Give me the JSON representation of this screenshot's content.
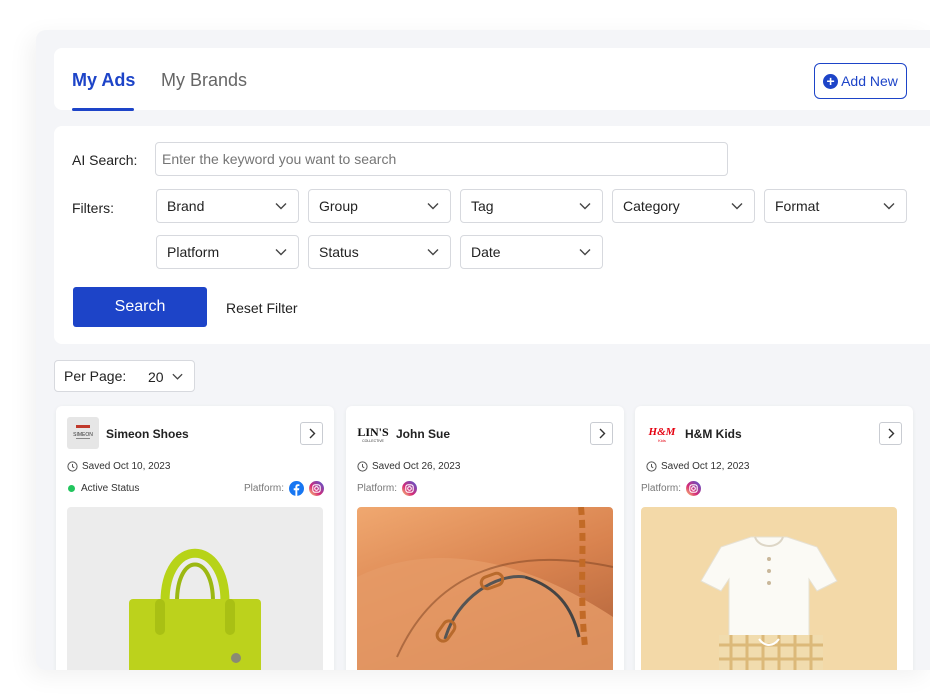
{
  "tabs": [
    {
      "label": "My Ads",
      "active": true
    },
    {
      "label": "My Brands",
      "active": false
    }
  ],
  "add_new": {
    "label": "Add New"
  },
  "ai_search": {
    "label": "AI Search:",
    "placeholder": "Enter the keyword you want to search",
    "value": ""
  },
  "filters": {
    "label": "Filters:",
    "dropdowns": [
      "Brand",
      "Group",
      "Tag",
      "Category",
      "Format",
      "Platform",
      "Status",
      "Date"
    ]
  },
  "search_button": "Search",
  "reset_filter": "Reset Filter",
  "per_page": {
    "label": "Per Page:",
    "value": "20"
  },
  "colors": {
    "accent": "#1d44c8",
    "active_status": "#22c55e",
    "background": "#f4f5f8"
  },
  "cards": [
    {
      "brand": "Simeon Shoes",
      "saved": "Saved Oct 10, 2023",
      "status": "Active Status",
      "platform_label": "Platform:",
      "platforms": [
        "facebook-icon",
        "instagram-icon"
      ],
      "logo_text": "SIMEON",
      "image": "lime-green-handbag"
    },
    {
      "brand": "John Sue",
      "saved": "Saved Oct 26, 2023",
      "platform_label": "Platform:",
      "platforms": [
        "instagram-icon"
      ],
      "logo_text": "LIN'S",
      "logo_subtext": "COLLECTIVE",
      "image": "chain-bracelet-on-arm"
    },
    {
      "brand": "H&M Kids",
      "saved": "Saved Oct 12, 2023",
      "platform_label": "Platform:",
      "platforms": [
        "instagram-icon"
      ],
      "logo_text": "H&M",
      "logo_subtext": "Kids",
      "image": "kids-shirt-and-plaid-shorts"
    }
  ]
}
